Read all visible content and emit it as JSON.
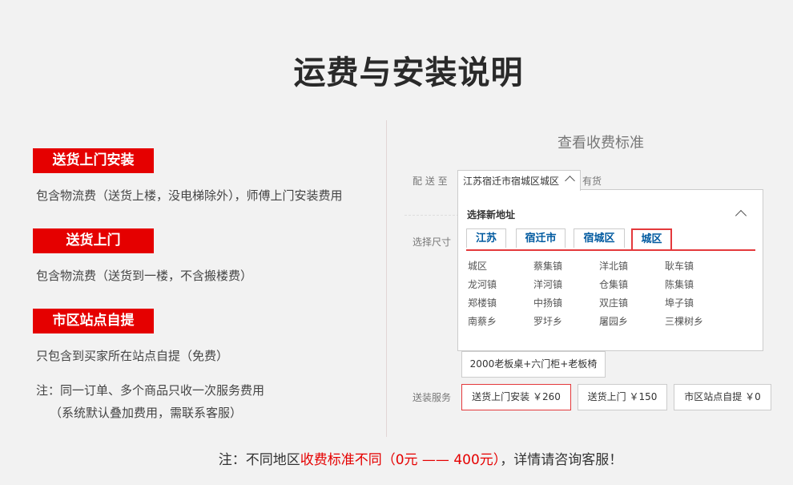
{
  "page_title": "运费与安装说明",
  "left": {
    "sections": [
      {
        "badge": "送货上门安装",
        "desc": "包含物流费（送货上楼，没电梯除外），师傅上门安装费用"
      },
      {
        "badge": "送货上门",
        "desc": "包含物流费（送货到一楼，不含搬楼费）"
      },
      {
        "badge": "市区站点自提",
        "desc": "只包含到买家所在站点自提（免费）"
      }
    ],
    "note_line1": "注：同一订单、多个商品只收一次服务费用",
    "note_line2": "（系统默认叠加费用，需联系客服）"
  },
  "right": {
    "title": "查看收费标准",
    "deliver_label": "配 送 至",
    "address_value": "江苏宿迁市宿城区城区",
    "stock_text": "有货",
    "size_label": "选择尺寸",
    "selector": {
      "title": "选择新地址",
      "tabs": [
        "江苏",
        "宿迁市",
        "宿城区",
        "城区"
      ],
      "areas": [
        "城区",
        "蔡集镇",
        "洋北镇",
        "耿车镇",
        "龙河镇",
        "洋河镇",
        "仓集镇",
        "陈集镇",
        "郑楼镇",
        "中扬镇",
        "双庄镇",
        "埠子镇",
        "南蔡乡",
        "罗圩乡",
        "屠园乡",
        "三棵树乡"
      ]
    },
    "size_option": "2000老板桌+六门柜+老板椅",
    "service_label": "送装服务",
    "services": [
      "送货上门安装 ￥260",
      "送货上门 ￥150",
      "市区站点自提 ￥0"
    ]
  },
  "bottom_note": {
    "prefix": "注：不同地区",
    "highlight": "收费标准不同（0元 —— 400元）",
    "suffix": "，详情请咨询客服！"
  },
  "colors": {
    "accent_red": "#e50000",
    "tab_blue": "#005aa0"
  }
}
